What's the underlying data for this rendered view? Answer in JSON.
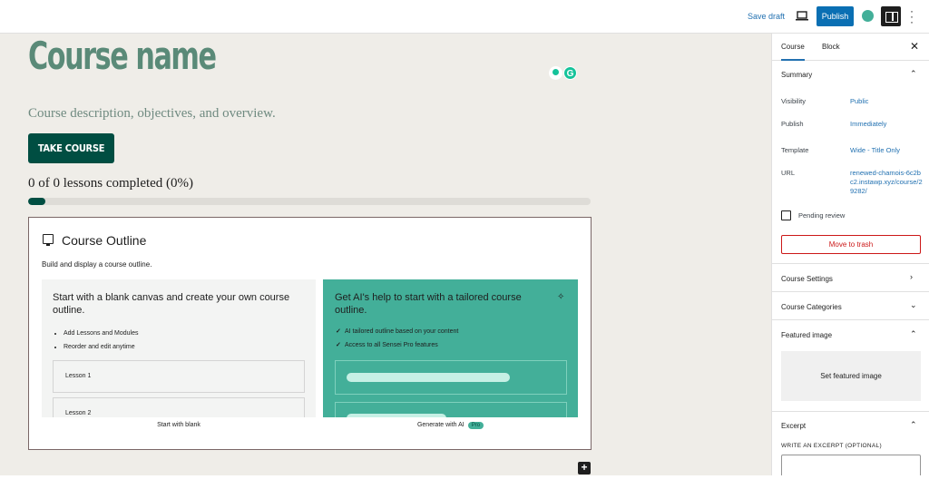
{
  "topbar": {
    "save_draft": "Save draft",
    "publish": "Publish"
  },
  "canvas": {
    "course_title": "Course name",
    "course_description": "Course description, objectives, and overview.",
    "take_course": "TAKE COURSE",
    "progress_text": "0 of 0 lessons completed (0%)",
    "progress_fraction": 0.03,
    "accent_color": "#004e42"
  },
  "outline": {
    "title": "Course Outline",
    "subtitle": "Build and display a course outline.",
    "blank_card": {
      "heading": "Start with a blank canvas and create your own course outline.",
      "bullets": [
        "Add Lessons and Modules",
        "Reorder and edit anytime"
      ],
      "lessons": [
        "Lesson 1",
        "Lesson 2"
      ],
      "caption": "Start with blank"
    },
    "ai_card": {
      "heading": "Get AI's help to start with a tailored course outline.",
      "checks": [
        "AI tailored outline based on your content",
        "Access to all Sensei Pro features"
      ],
      "caption": "Generate with AI",
      "badge": "Pro",
      "color": "#43af99"
    }
  },
  "sidebar": {
    "tabs": [
      "Course",
      "Block"
    ],
    "summary": {
      "title": "Summary",
      "visibility_label": "Visibility",
      "visibility_value": "Public",
      "publish_label": "Publish",
      "publish_value": "Immediately",
      "template_label": "Template",
      "template_value": "Wide - Title Only",
      "url_label": "URL",
      "url_value": "renewed-chamois-6c2bc2.instawp.xyz/course/29282/",
      "pending_review": "Pending review",
      "move_to_trash": "Move to trash"
    },
    "course_settings": "Course Settings",
    "course_categories": "Course Categories",
    "featured_image": {
      "title": "Featured image",
      "button": "Set featured image"
    },
    "excerpt": {
      "title": "Excerpt",
      "label": "WRITE AN EXCERPT (OPTIONAL)"
    }
  }
}
